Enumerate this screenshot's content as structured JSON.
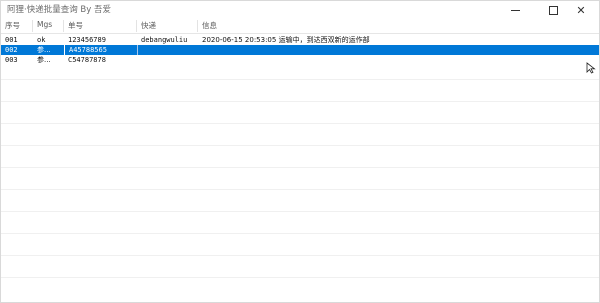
{
  "window": {
    "title": "阿狸·快递批量查询  By 吾爱",
    "controls": {
      "minimize": "—",
      "maximize": "□",
      "close": "✕"
    }
  },
  "list": {
    "columns": [
      "序号",
      "Mgs",
      "单号",
      "快递",
      "信息"
    ],
    "rows": [
      {
        "no": "001",
        "mgs": "ok",
        "tracking": "123456789",
        "courier": "debangwuliu",
        "info": "2020-06-15 20:53:05    运输中，到达西双新的运作部",
        "selected": false
      },
      {
        "no": "002",
        "mgs": "参...",
        "tracking": "A45788565",
        "courier": "",
        "info": "",
        "selected": true
      },
      {
        "no": "003",
        "mgs": "参...",
        "tracking": "C54787878",
        "courier": "",
        "info": "",
        "selected": false
      }
    ]
  },
  "colors": {
    "selection": "#0078d7",
    "title_text": "#6b6b6b"
  }
}
